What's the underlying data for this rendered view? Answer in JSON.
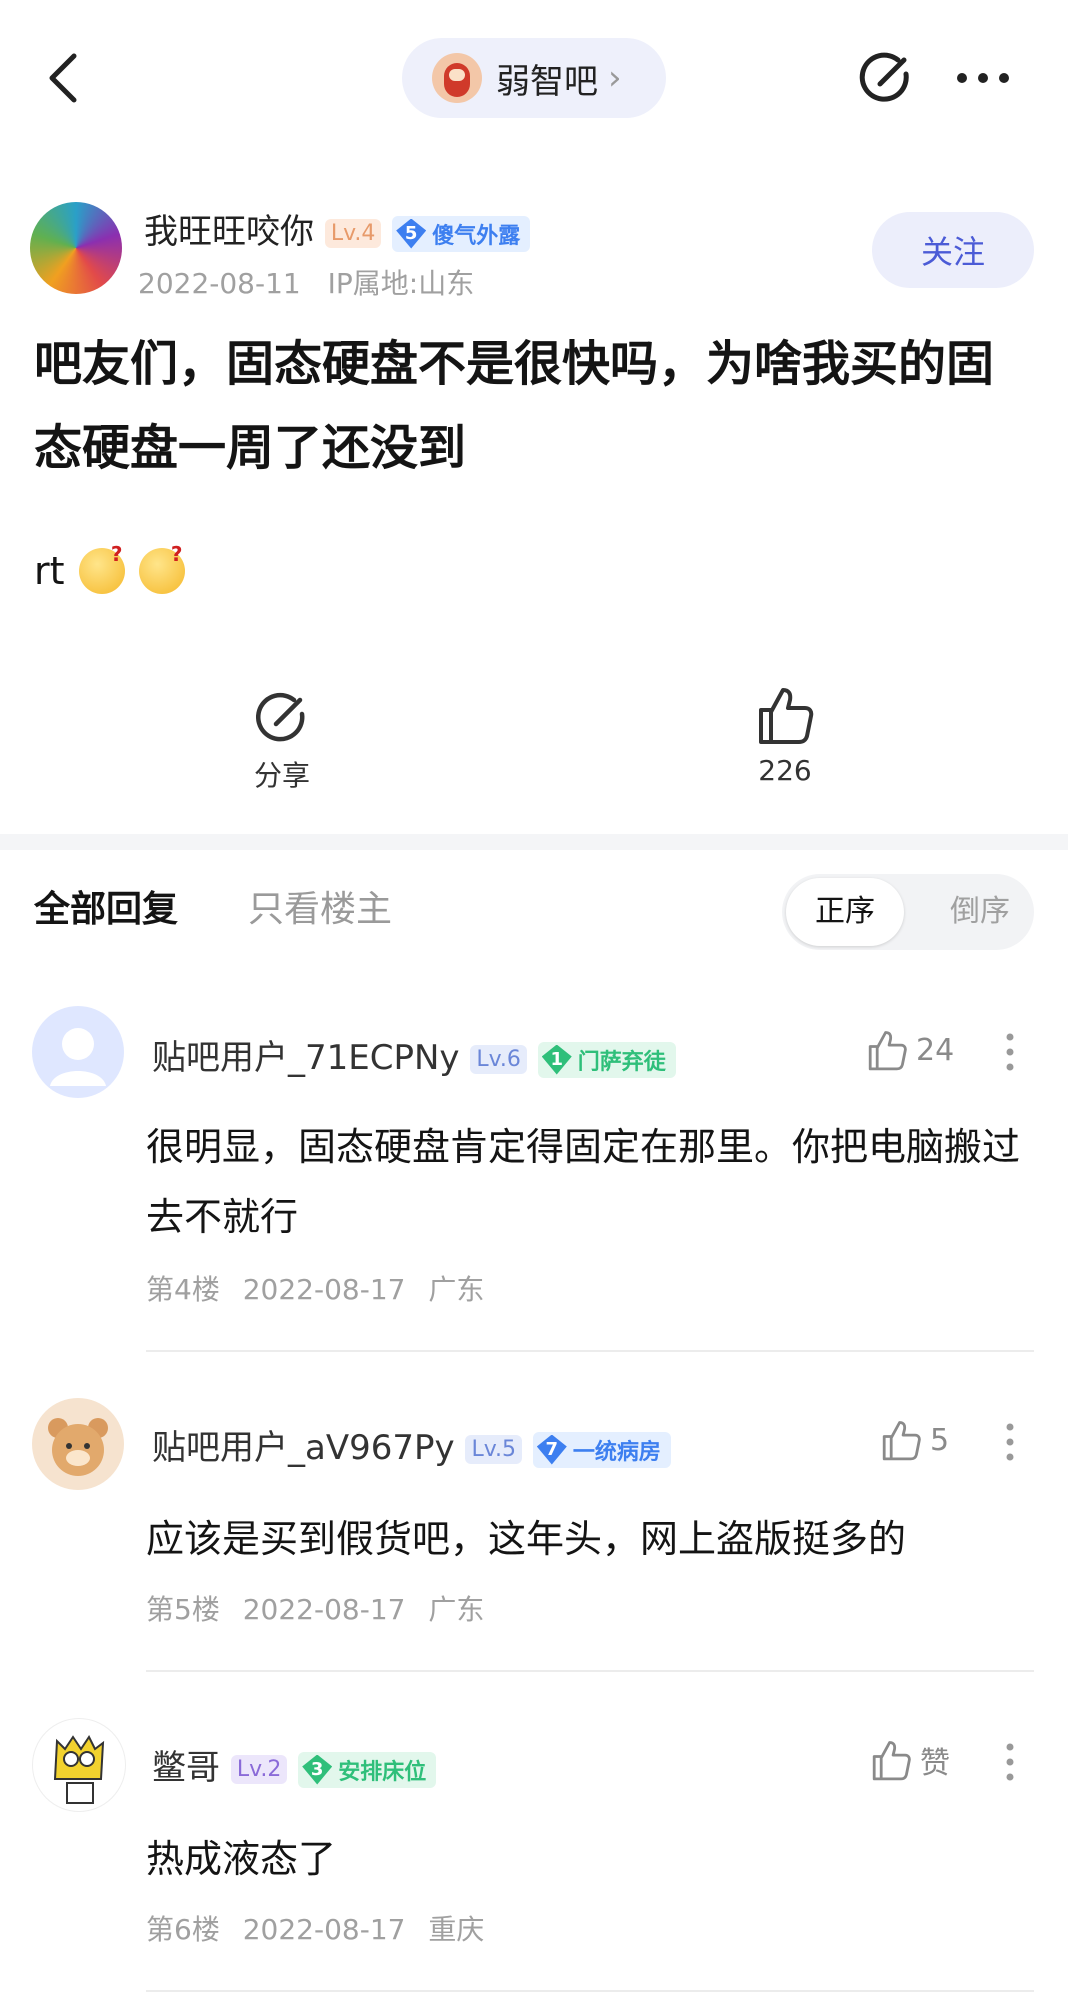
{
  "header": {
    "forum_name": "弱智吧",
    "chevron": "›"
  },
  "post": {
    "author": "我旺旺咬你",
    "level": "Lv.4",
    "badge_num": "5",
    "badge_title": "傻气外露",
    "date": "2022-08-11",
    "ip": "IP属地:山东",
    "follow_label": "关注",
    "title": "吧友们，固态硬盘不是很快吗，为啥我买的固态硬盘一周了还没到",
    "body": "rt",
    "share_label": "分享",
    "likes": "226"
  },
  "tabs": {
    "all": "全部回复",
    "owner_only": "只看楼主"
  },
  "sort": {
    "asc": "正序",
    "desc": "倒序"
  },
  "comments": [
    {
      "user": "贴吧用户_71ECPNy",
      "level": "Lv.6",
      "badge_num": "1",
      "badge_title": "门萨弃徒",
      "likes": "24",
      "text": "很明显，固态硬盘肯定得固定在那里。你把电脑搬过去不就行",
      "floor": "第4楼",
      "date": "2022-08-17",
      "region": "广东"
    },
    {
      "user": "贴吧用户_aV967Py",
      "level": "Lv.5",
      "badge_num": "7",
      "badge_title": "一统病房",
      "likes": "5",
      "text": "应该是买到假货吧，这年头，网上盗版挺多的",
      "floor": "第5楼",
      "date": "2022-08-17",
      "region": "广东"
    },
    {
      "user": "鳖哥",
      "level": "Lv.2",
      "badge_num": "3",
      "badge_title": "安排床位",
      "likes": "赞",
      "text": "热成液态了",
      "floor": "第6楼",
      "date": "2022-08-17",
      "region": "重庆"
    }
  ],
  "colors": {
    "accent": "#4b5bd6",
    "badge_blue": "#3d7ff0",
    "badge_green": "#2fbf7a"
  },
  "icons": [
    "back-icon",
    "share-icon",
    "more-icon",
    "thumbs-up-icon",
    "emoji-icon"
  ]
}
